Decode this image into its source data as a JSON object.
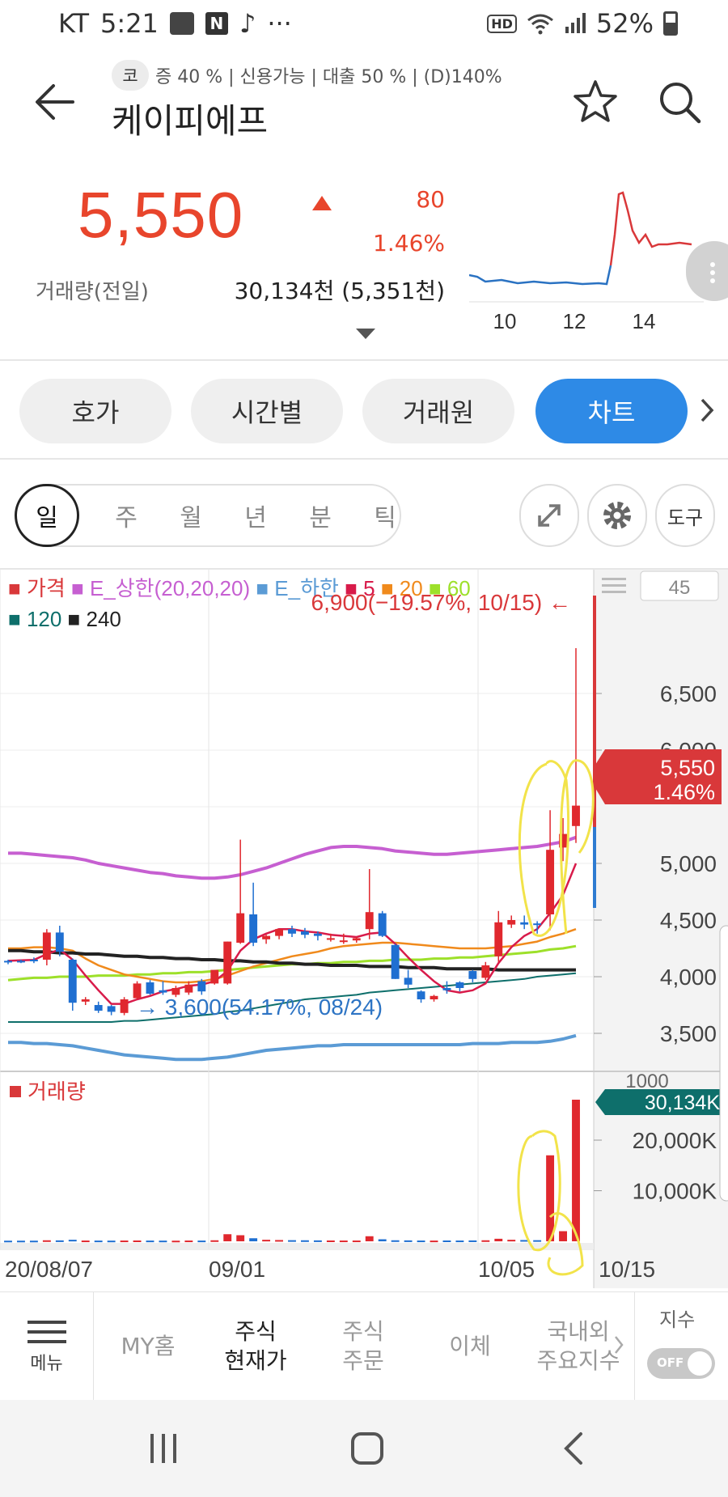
{
  "status_bar": {
    "carrier": "KT",
    "time": "5:21",
    "hd": "HD",
    "battery": "52%",
    "dots": "···"
  },
  "header": {
    "market_badge": "코",
    "tagline": "증 40 % | 신용가능 | 대출 50 % | (D)140%",
    "stock_name": "케이피에프"
  },
  "quote": {
    "price": "5,550",
    "change": "80",
    "change_pct": "1.46%",
    "volume_label": "거래량(전일)",
    "volume_value": "30,134천 (5,351천)",
    "mini_chart_xticks": [
      "10",
      "12",
      "14"
    ]
  },
  "tabs": [
    {
      "label": "호가",
      "active": false
    },
    {
      "label": "시간별",
      "active": false
    },
    {
      "label": "거래원",
      "active": false
    },
    {
      "label": "차트",
      "active": true
    }
  ],
  "periods": [
    "일",
    "주",
    "월",
    "년",
    "분",
    "틱"
  ],
  "tools": {
    "tool_label": "도구"
  },
  "chart": {
    "legend_row1": [
      {
        "label": "가격",
        "color": "#d9383a"
      },
      {
        "label": "E_상한(20,20,20)",
        "color": "#c65fd1"
      },
      {
        "label": "E_하한",
        "color": "#5b9bd5"
      },
      {
        "label": "5",
        "color": "#d81b4a"
      },
      {
        "label": "20",
        "color": "#f08a1c"
      },
      {
        "label": "60",
        "color": "#9de02a"
      }
    ],
    "legend_row2": [
      {
        "label": "120",
        "color": "#0e6f6b"
      },
      {
        "label": "240",
        "color": "#222222"
      }
    ],
    "count_box": "45",
    "high_annotation": "6,900(−19.57%, 10/15) ←",
    "low_annotation": "→ 3,600(54.17%, 08/24)",
    "price_badge_value": "5,550",
    "price_badge_pct": "1.46%",
    "volume_title": "거래량",
    "volume_badge": "30,134K",
    "volume_axis_top_partial": "1000",
    "date_labels": [
      "20/08/07",
      "09/01",
      "10/05",
      "10/15"
    ]
  },
  "chart_data": {
    "type": "candlestick",
    "price_axis_ticks": [
      3500,
      4000,
      4500,
      5000,
      5500,
      6000,
      6500
    ],
    "price_ylim": [
      3200,
      6950
    ],
    "volume_axis_ticks": [
      "10,000K",
      "20,000K"
    ],
    "volume_ylim": [
      0,
      32000
    ],
    "x_labels": [
      "20/08/07",
      "09/01",
      "10/05",
      "10/15"
    ],
    "current_price": 5550,
    "high": {
      "value": 6900,
      "date": "10/15",
      "pct": "-19.57%"
    },
    "low": {
      "value": 3600,
      "date": "08/24",
      "pct": "54.17%"
    },
    "candles": [
      [
        4140,
        4150,
        4110,
        4130,
        "down"
      ],
      [
        4130,
        4150,
        4120,
        4140,
        "down"
      ],
      [
        4140,
        4170,
        4120,
        4150,
        "down"
      ],
      [
        4150,
        4420,
        4100,
        4390,
        "up"
      ],
      [
        4390,
        4450,
        4180,
        4220,
        "down"
      ],
      [
        4150,
        4160,
        3700,
        3770,
        "down"
      ],
      [
        3780,
        3820,
        3750,
        3800,
        "up"
      ],
      [
        3750,
        3780,
        3680,
        3700,
        "down"
      ],
      [
        3690,
        3750,
        3660,
        3740,
        "down"
      ],
      [
        3680,
        3820,
        3660,
        3800,
        "up"
      ],
      [
        3810,
        3960,
        3800,
        3940,
        "up"
      ],
      [
        3850,
        3970,
        3840,
        3950,
        "down"
      ],
      [
        3860,
        3960,
        3840,
        3880,
        "down"
      ],
      [
        3840,
        3920,
        3820,
        3900,
        "up"
      ],
      [
        3860,
        3960,
        3840,
        3930,
        "up"
      ],
      [
        3870,
        3980,
        3840,
        3960,
        "down"
      ],
      [
        3940,
        4060,
        3930,
        4060,
        "up"
      ],
      [
        3940,
        4310,
        3930,
        4310,
        "up"
      ],
      [
        4300,
        5210,
        4290,
        4560,
        "up"
      ],
      [
        4550,
        4830,
        4270,
        4300,
        "down"
      ],
      [
        4330,
        4370,
        4290,
        4360,
        "up"
      ],
      [
        4360,
        4420,
        4330,
        4420,
        "up"
      ],
      [
        4420,
        4450,
        4350,
        4380,
        "down"
      ],
      [
        4370,
        4430,
        4340,
        4400,
        "down"
      ],
      [
        4380,
        4400,
        4320,
        4360,
        "down"
      ],
      [
        4340,
        4380,
        4310,
        4330,
        "up"
      ],
      [
        4320,
        4380,
        4290,
        4320,
        "up"
      ],
      [
        4320,
        4350,
        4300,
        4340,
        "up"
      ],
      [
        4420,
        4950,
        4330,
        4570,
        "up"
      ],
      [
        4560,
        4580,
        4350,
        4360,
        "down"
      ],
      [
        4280,
        4290,
        3980,
        3980,
        "down"
      ],
      [
        3990,
        4060,
        3900,
        3930,
        "down"
      ],
      [
        3870,
        3880,
        3770,
        3800,
        "down"
      ],
      [
        3800,
        3840,
        3780,
        3830,
        "up"
      ],
      [
        3900,
        3960,
        3850,
        3880,
        "down"
      ],
      [
        3900,
        3960,
        3870,
        3950,
        "down"
      ],
      [
        3980,
        4060,
        3950,
        4050,
        "down"
      ],
      [
        3990,
        4130,
        3970,
        4100,
        "up"
      ],
      [
        4180,
        4580,
        4130,
        4480,
        "up"
      ],
      [
        4460,
        4540,
        4430,
        4500,
        "up"
      ],
      [
        4460,
        4540,
        4420,
        4480,
        "down"
      ],
      [
        4470,
        4490,
        4380,
        4460,
        "down"
      ],
      [
        4550,
        5470,
        4410,
        5120,
        "up"
      ],
      [
        5140,
        5400,
        5020,
        5260,
        "up"
      ],
      [
        5330,
        6900,
        5180,
        5510,
        "up"
      ]
    ],
    "volumes": [
      120,
      120,
      120,
      200,
      180,
      300,
      150,
      140,
      130,
      150,
      160,
      140,
      130,
      120,
      150,
      140,
      200,
      1400,
      1200,
      600,
      300,
      250,
      220,
      200,
      180,
      160,
      150,
      150,
      1000,
      400,
      200,
      180,
      150,
      140,
      160,
      150,
      170,
      200,
      500,
      300,
      250,
      220,
      17000,
      2000,
      28000
    ],
    "ma5": [
      4140,
      4145,
      4148,
      4200,
      4240,
      4150,
      4010,
      3880,
      3760,
      3760,
      3800,
      3830,
      3870,
      3890,
      3920,
      3930,
      3960,
      4050,
      4230,
      4330,
      4380,
      4420,
      4420,
      4400,
      4390,
      4370,
      4360,
      4350,
      4380,
      4390,
      4290,
      4170,
      4060,
      3960,
      3880,
      3860,
      3880,
      3940,
      4120,
      4260,
      4360,
      4420,
      4560,
      4720,
      5000
    ],
    "ma20": [
      4250,
      4250,
      4260,
      4260,
      4250,
      4230,
      4160,
      4100,
      4060,
      4020,
      4000,
      3980,
      3960,
      3950,
      3950,
      3960,
      3980,
      4010,
      4050,
      4090,
      4120,
      4150,
      4180,
      4200,
      4220,
      4250,
      4270,
      4280,
      4290,
      4300,
      4300,
      4290,
      4280,
      4270,
      4260,
      4250,
      4250,
      4250,
      4260,
      4270,
      4290,
      4310,
      4350,
      4380,
      4420
    ],
    "ma60": [
      3970,
      3980,
      3990,
      3990,
      4000,
      4000,
      4000,
      4010,
      4010,
      4010,
      4020,
      4020,
      4030,
      4030,
      4040,
      4040,
      4050,
      4060,
      4070,
      4080,
      4090,
      4100,
      4110,
      4110,
      4120,
      4120,
      4130,
      4130,
      4140,
      4140,
      4150,
      4150,
      4150,
      4160,
      4160,
      4170,
      4170,
      4180,
      4190,
      4200,
      4210,
      4220,
      4240,
      4250,
      4270
    ],
    "ma120": [
      3600,
      3600,
      3600,
      3600,
      3600,
      3600,
      3600,
      3600,
      3600,
      3610,
      3610,
      3620,
      3630,
      3640,
      3650,
      3660,
      3670,
      3690,
      3700,
      3720,
      3740,
      3760,
      3780,
      3800,
      3810,
      3820,
      3830,
      3840,
      3860,
      3870,
      3880,
      3890,
      3900,
      3910,
      3920,
      3930,
      3940,
      3950,
      3960,
      3970,
      3980,
      4000,
      4010,
      4020,
      4030
    ],
    "ma240": [
      4230,
      4230,
      4220,
      4220,
      4210,
      4210,
      4200,
      4200,
      4190,
      4180,
      4180,
      4170,
      4170,
      4160,
      4160,
      4150,
      4150,
      4140,
      4140,
      4130,
      4130,
      4120,
      4120,
      4110,
      4110,
      4100,
      4100,
      4100,
      4090,
      4090,
      4090,
      4080,
      4080,
      4080,
      4070,
      4070,
      4070,
      4070,
      4060,
      4060,
      4060,
      4060,
      4060,
      4060,
      4060
    ],
    "env_upper": [
      5090,
      5090,
      5080,
      5070,
      5060,
      5050,
      5030,
      5000,
      4980,
      4960,
      4940,
      4920,
      4910,
      4890,
      4880,
      4870,
      4870,
      4880,
      4900,
      4930,
      4960,
      5000,
      5040,
      5080,
      5110,
      5140,
      5150,
      5150,
      5140,
      5130,
      5110,
      5100,
      5090,
      5080,
      5080,
      5090,
      5100,
      5110,
      5120,
      5130,
      5140,
      5150,
      5170,
      5190,
      5230
    ],
    "env_lower": [
      3420,
      3420,
      3410,
      3410,
      3400,
      3390,
      3370,
      3350,
      3330,
      3310,
      3300,
      3290,
      3280,
      3270,
      3270,
      3270,
      3280,
      3290,
      3310,
      3330,
      3350,
      3360,
      3370,
      3380,
      3390,
      3390,
      3400,
      3400,
      3400,
      3400,
      3400,
      3400,
      3400,
      3400,
      3400,
      3400,
      3410,
      3410,
      3410,
      3420,
      3420,
      3420,
      3430,
      3450,
      3480
    ]
  },
  "bottom_nav": {
    "menu": "메뉴",
    "items": [
      {
        "label": "MY홈",
        "current": false
      },
      {
        "label": "주식\n현재가",
        "current": true
      },
      {
        "label": "주식\n주문",
        "current": false
      },
      {
        "label": "이체",
        "current": false
      },
      {
        "label": "국내외\n주요지수",
        "current": false
      }
    ],
    "index_label": "지수",
    "toggle_text": "OFF"
  }
}
